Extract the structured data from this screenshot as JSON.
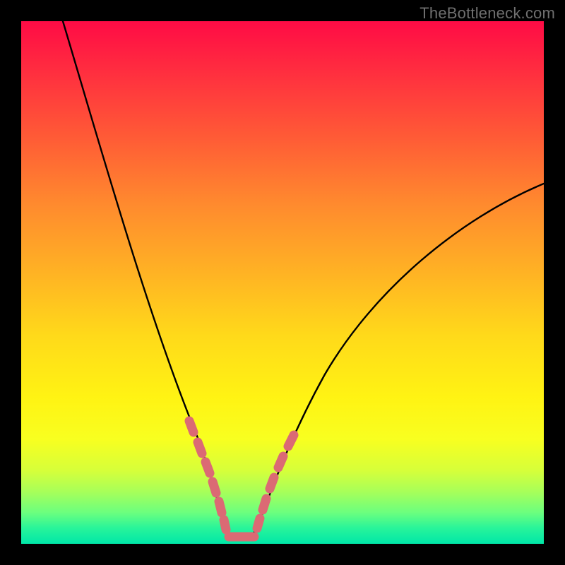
{
  "watermark": "TheBottleneck.com",
  "chart_data": {
    "type": "line",
    "title": "",
    "xlabel": "",
    "ylabel": "",
    "xlim": [
      0,
      100
    ],
    "ylim": [
      0,
      100
    ],
    "series": [
      {
        "name": "bottleneck-curve",
        "x": [
          8,
          12,
          16,
          20,
          24,
          28,
          30,
          32,
          34,
          36,
          37,
          38,
          39,
          40,
          41,
          42,
          43,
          44,
          46,
          48,
          52,
          58,
          66,
          76,
          88,
          100
        ],
        "y": [
          100,
          88,
          76,
          64,
          52,
          40,
          33,
          26,
          19,
          12,
          8,
          5,
          3,
          2,
          2,
          3,
          5,
          8,
          13,
          18,
          26,
          35,
          44,
          52,
          59,
          65
        ]
      }
    ],
    "highlight_segments": [
      {
        "name": "left-dots",
        "x_range": [
          30,
          37
        ],
        "color": "#db6a74"
      },
      {
        "name": "right-dots",
        "x_range": [
          44,
          50
        ],
        "color": "#db6a74"
      }
    ],
    "background_gradient": {
      "top": "#ff0b45",
      "mid": "#ffe719",
      "bottom": "#00e7a8"
    }
  }
}
